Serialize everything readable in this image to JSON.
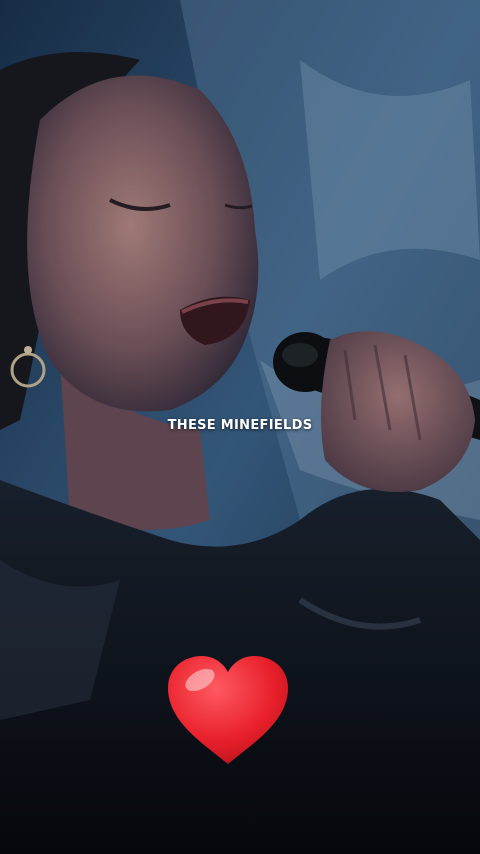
{
  "video": {
    "caption": "THESE MINEFIELDS",
    "scene": "singer-with-microphone"
  },
  "overlay": {
    "sticker": "red-heart-emoji",
    "sticker_color": "#e8202b"
  },
  "colors": {
    "background": "#2b4a70",
    "caption_text": "#ffffff"
  }
}
